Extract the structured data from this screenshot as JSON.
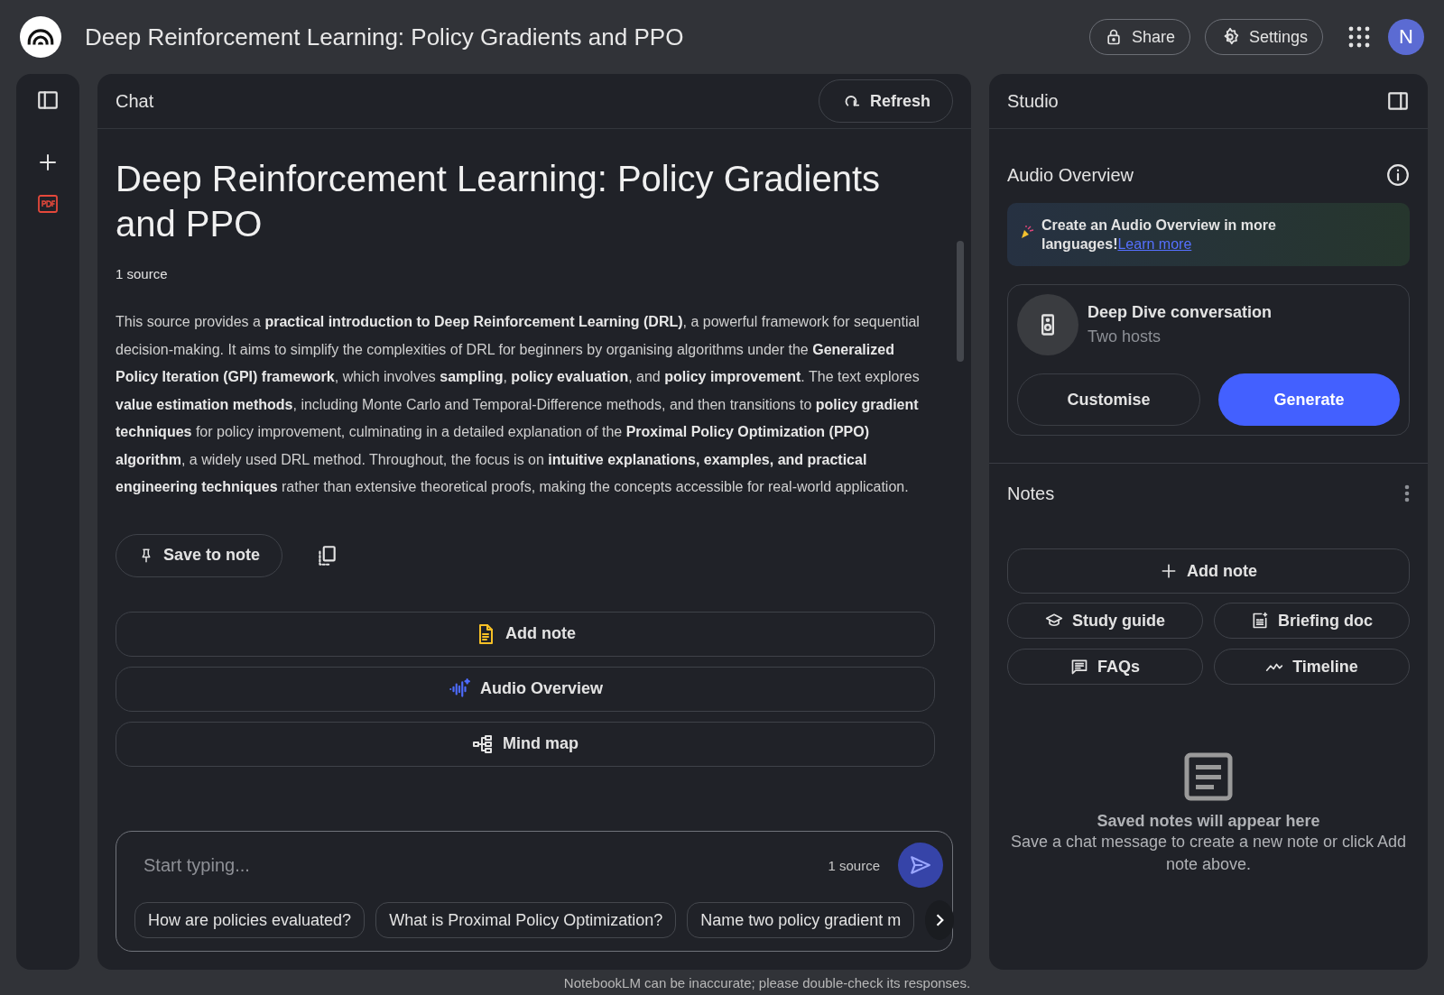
{
  "header": {
    "title": "Deep Reinforcement Learning: Policy Gradients and PPO",
    "share": "Share",
    "settings": "Settings",
    "avatar": "N"
  },
  "chat": {
    "title": "Chat",
    "refresh": "Refresh",
    "heading": "Deep Reinforcement Learning: Policy Gradients and PPO",
    "source_count": "1 source",
    "summary": "This source provides a **practical introduction to Deep Reinforcement Learning (DRL)**, a powerful framework for sequential decision-making. It aims to simplify the complexities of DRL for beginners by organising algorithms under the **Generalized Policy Iteration (GPI) framework**, which involves **sampling**, **policy evaluation**, and **policy improvement**. The text explores **value estimation methods**, including Monte Carlo and Temporal-Difference methods, and then transitions to **policy gradient techniques** for policy improvement, culminating in a detailed explanation of the **Proximal Policy Optimization (PPO) algorithm**, a widely used DRL method. Throughout, the focus is on **intuitive explanations, examples, and practical engineering techniques** rather than extensive theoretical proofs, making the concepts accessible for real-world application.",
    "save_to_note": "Save to note",
    "actions": [
      {
        "kind": "note",
        "label": "Add note"
      },
      {
        "kind": "audio",
        "label": "Audio Overview"
      },
      {
        "kind": "mindmap",
        "label": "Mind map"
      }
    ],
    "input": {
      "placeholder": "Start typing...",
      "source_count": "1 source"
    },
    "suggestions": [
      "How are policies evaluated?",
      "What is Proximal Policy Optimization?",
      "Name two policy gradient m"
    ]
  },
  "studio": {
    "title": "Studio",
    "audio_overview": {
      "title": "Audio Overview",
      "banner": {
        "text": "Create an Audio Overview in more languages!",
        "link": "Learn more"
      },
      "card": {
        "title": "Deep Dive conversation",
        "subtitle": "Two hosts"
      },
      "customise": "Customise",
      "generate": "Generate"
    },
    "notes": {
      "title": "Notes",
      "add_note": "Add note",
      "tools": [
        {
          "kind": "study",
          "label": "Study guide"
        },
        {
          "kind": "briefing",
          "label": "Briefing doc"
        },
        {
          "kind": "faq",
          "label": "FAQs"
        },
        {
          "kind": "timeline",
          "label": "Timeline"
        }
      ],
      "empty": {
        "title": "Saved notes will appear here",
        "body": "Save a chat message to create a new note or click Add note above."
      }
    }
  },
  "footer": "NotebookLM can be inaccurate; please double-check its responses."
}
